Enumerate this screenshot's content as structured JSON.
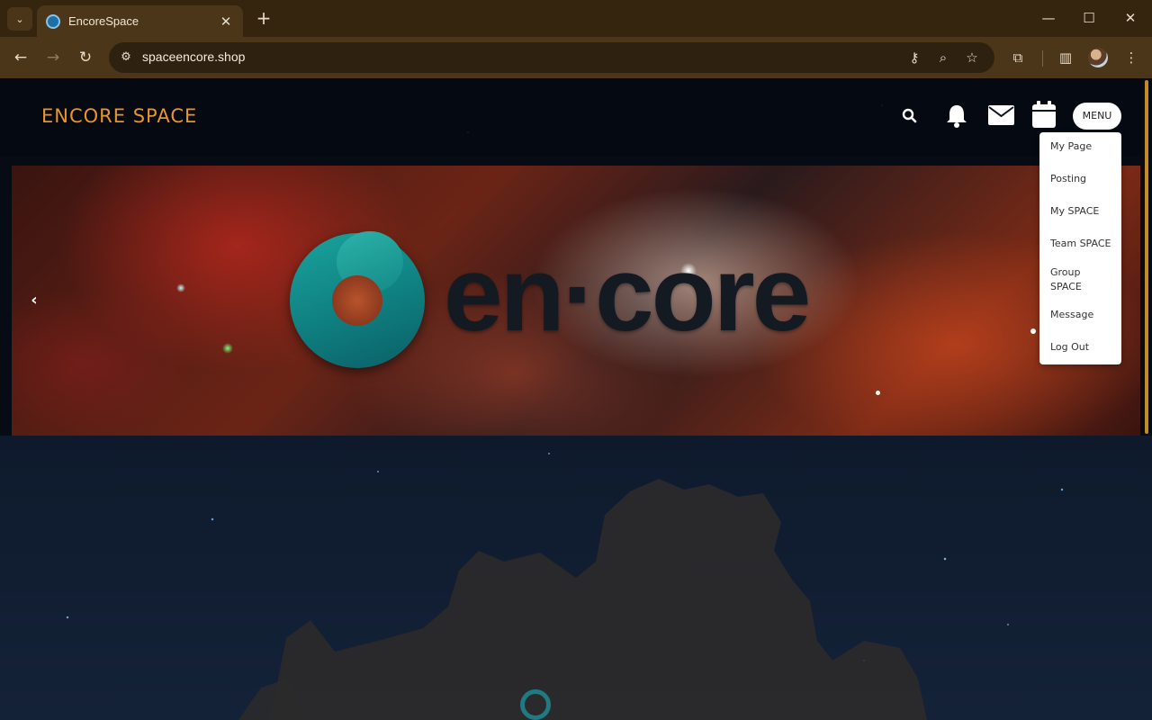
{
  "browser": {
    "tab_title": "EncoreSpace",
    "tab_close": "✕",
    "new_tab": "+",
    "url": "spaceencore.shop",
    "win_minimize": "—",
    "win_maximize": "☐",
    "win_close": "✕"
  },
  "site": {
    "title": "ENCORE SPACE",
    "menu_label": "MENU",
    "banner_logo_text": "en·core",
    "carousel": {
      "slides": 3,
      "active_index": 2
    }
  },
  "menu": {
    "items": [
      "My Page",
      "Posting",
      "My SPACE",
      "Team SPACE",
      "Group SPACE",
      "Message",
      "Log Out"
    ]
  },
  "colors": {
    "chrome_bg": "#35250f",
    "toolbar_bg": "#4b3619",
    "site_title": "#e9942a",
    "logo_teal": "#1aa39d"
  },
  "icons": {
    "search": "search-icon",
    "bell": "bell-icon",
    "mail": "mail-icon",
    "calendar": "calendar-icon"
  }
}
